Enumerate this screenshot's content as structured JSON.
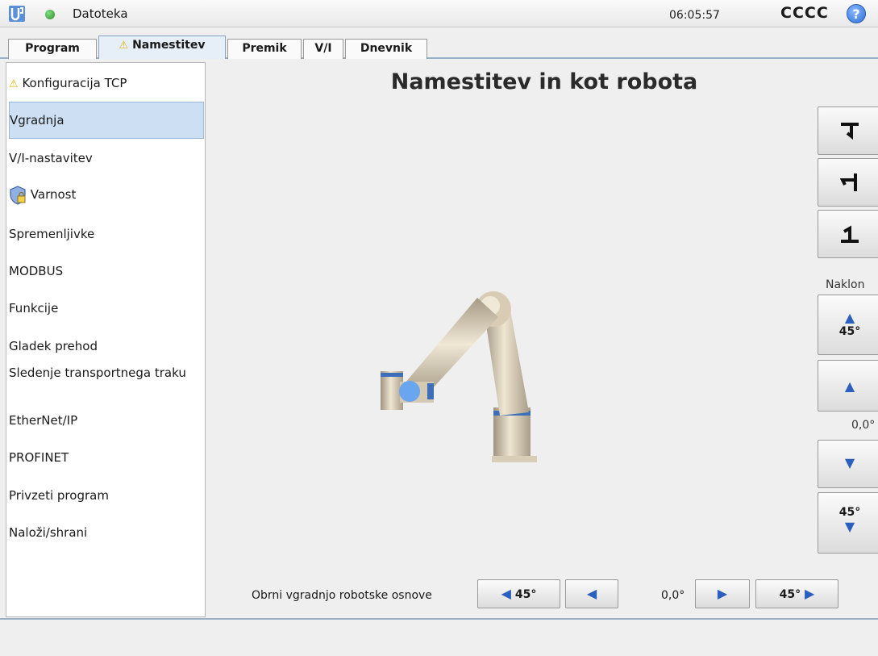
{
  "topbar": {
    "file_label": "Datoteka",
    "time": "06:05:57",
    "robot_name": "CCCC",
    "help_glyph": "?"
  },
  "tabs": [
    {
      "label": "Program",
      "warning": false
    },
    {
      "label": "Namestitev",
      "warning": true,
      "active": true
    },
    {
      "label": "Premik",
      "warning": false
    },
    {
      "label": "V/I",
      "warning": false
    },
    {
      "label": "Dnevnik",
      "warning": false
    }
  ],
  "sidebar": {
    "items": [
      {
        "label": "Konfiguracija TCP",
        "icon": "warning-icon"
      },
      {
        "label": "Vgradnja",
        "selected": true
      },
      {
        "label": "V/I-nastavitev"
      },
      {
        "label": "Varnost",
        "icon": "shield-lock-icon"
      },
      {
        "label": "Spremenljivke"
      },
      {
        "label": "MODBUS"
      },
      {
        "label": "Funkcije"
      },
      {
        "label": "Gladek prehod"
      },
      {
        "label": "Sledenje transportnega traku"
      },
      {
        "label": "EtherNet/IP"
      },
      {
        "label": "PROFINET"
      },
      {
        "label": "Privzeti program"
      },
      {
        "label": "Naloži/shrani"
      }
    ]
  },
  "main": {
    "title": "Namestitev in kot robota",
    "tilt_label": "Naklon",
    "tilt_up_big": "45°",
    "tilt_value": "0,0°",
    "tilt_down_big": "45°",
    "rotate_label": "Obrni vgradnjo robotske osnove",
    "rotate_left_big": "45°",
    "rotate_value": "0,0°",
    "rotate_right_big": "45°"
  },
  "colors": {
    "accent": "#2a5fbf",
    "selection": "#cddff3",
    "warning": "#e0b300"
  }
}
